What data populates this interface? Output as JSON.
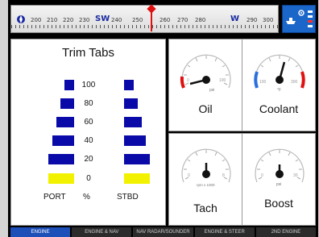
{
  "compass": {
    "labels": [
      "200",
      "210",
      "220",
      "230",
      "240",
      "250",
      "260",
      "270",
      "280",
      "290",
      "300"
    ],
    "major": [
      {
        "label": "SW"
      },
      {
        "label": "W"
      }
    ],
    "heading_marker_color": "#e01010"
  },
  "status_panel": {
    "color": "#1b66c9",
    "icons": [
      "boat-icon",
      "gps-icon",
      "signal-icon"
    ]
  },
  "trim": {
    "title": "Trim Tabs",
    "levels": [
      "100",
      "80",
      "60",
      "40",
      "20",
      "0"
    ],
    "port_label": "PORT",
    "unit_label": "%",
    "stbd_label": "STBD",
    "port_value_percent": 0,
    "stbd_value_percent": 0,
    "bar_color": "#0a0aa8",
    "zero_color": "#f2f200"
  },
  "gauges": {
    "oil": {
      "label": "Oil",
      "unit": "psi",
      "min": "0",
      "max": "100",
      "needle_fraction": 0.1
    },
    "coolant": {
      "label": "Coolant",
      "unit": "°F",
      "min": "100",
      "max": "300",
      "needle_fraction": 0.35
    },
    "tach": {
      "label": "Tach",
      "unit": "rpm x 1000",
      "min": "0",
      "max": "8",
      "needle_fraction": 0.0
    },
    "boost": {
      "label": "Boost",
      "unit": "psi",
      "min": "0",
      "max": "30",
      "needle_fraction": 0.0
    }
  },
  "tabs": [
    {
      "label": "ENGINE",
      "active": true
    },
    {
      "label": "ENGINE & NAV",
      "active": false
    },
    {
      "label": "NAV RADAR/SOUNDER",
      "active": false
    },
    {
      "label": "ENGINE & STEER",
      "active": false
    },
    {
      "label": "2ND ENGINE",
      "active": false
    }
  ]
}
